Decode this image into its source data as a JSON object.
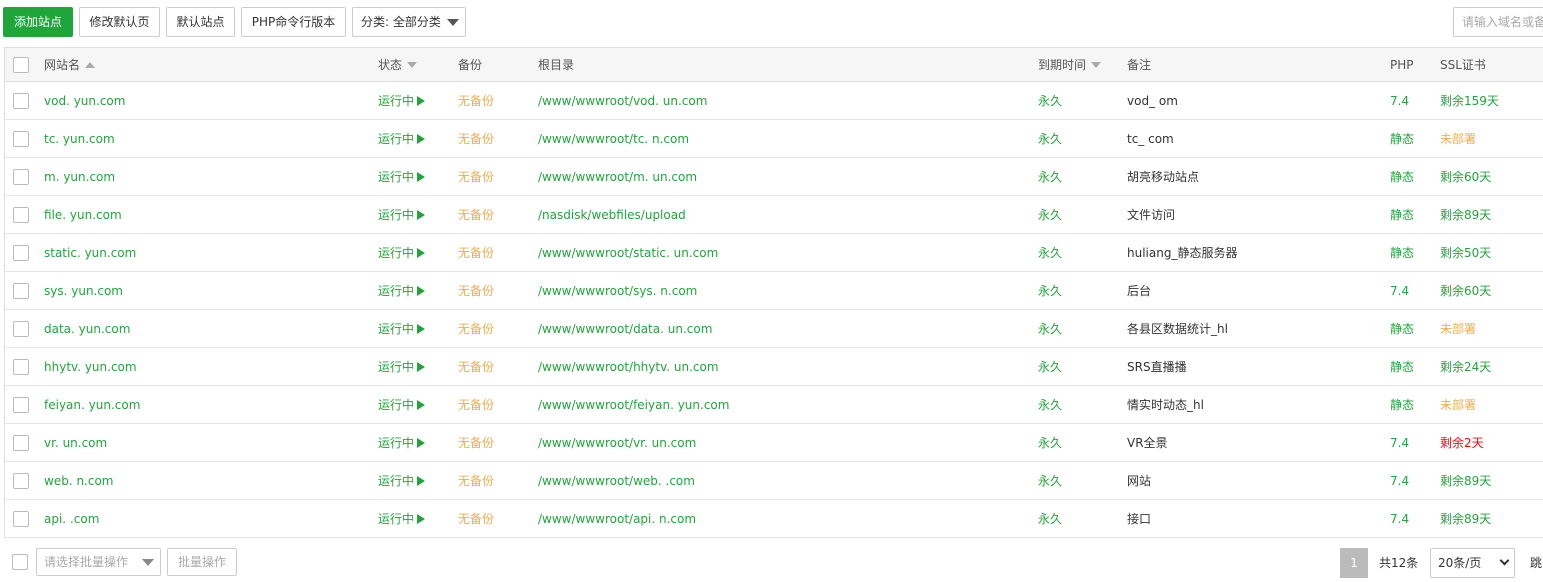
{
  "toolbar": {
    "add_site": "添加站点",
    "edit_default_page": "修改默认页",
    "default_site": "默认站点",
    "php_cli_version": "PHP命令行版本",
    "category": "分类: 全部分类",
    "search_placeholder": "请输入域名或备注"
  },
  "table": {
    "headers": {
      "name": "网站名",
      "status": "状态",
      "backup": "备份",
      "root": "根目录",
      "expire": "到期时间",
      "remark": "备注",
      "php": "PHP",
      "ssl": "SSL证书"
    },
    "rows": [
      {
        "name": "vod.                    yun.com",
        "status": "运行中",
        "backup": "无备份",
        "root": "/www/wwwroot/vod.                    un.com",
        "expire": "永久",
        "remark": "vod_                              om",
        "php": "7.4",
        "ssl": "剩余159天",
        "ssl_state": "ok"
      },
      {
        "name": "tc.                       yun.com",
        "status": "运行中",
        "backup": "无备份",
        "root": "/www/wwwroot/tc.                      n.com",
        "expire": "永久",
        "remark": "tc_                                com",
        "php": "静态",
        "ssl": "未部署",
        "ssl_state": "none"
      },
      {
        "name": "m.                        yun.com",
        "status": "运行中",
        "backup": "无备份",
        "root": "/www/wwwroot/m.                       un.com",
        "expire": "永久",
        "remark": "胡亮移动站点",
        "php": "静态",
        "ssl": "剩余60天",
        "ssl_state": "ok"
      },
      {
        "name": "file.                     yun.com",
        "status": "运行中",
        "backup": "无备份",
        "root": "/nasdisk/webfiles/upload",
        "expire": "永久",
        "remark": "文件访问",
        "php": "静态",
        "ssl": "剩余89天",
        "ssl_state": "ok"
      },
      {
        "name": "static.                   yun.com",
        "status": "运行中",
        "backup": "无备份",
        "root": "/www/wwwroot/static.                   un.com",
        "expire": "永久",
        "remark": "huliang_静态服务器",
        "php": "静态",
        "ssl": "剩余50天",
        "ssl_state": "ok"
      },
      {
        "name": "sys.                      yun.com",
        "status": "运行中",
        "backup": "无备份",
        "root": "/www/wwwroot/sys.                      n.com",
        "expire": "永久",
        "remark": "后台",
        "php": "7.4",
        "ssl": "剩余60天",
        "ssl_state": "ok"
      },
      {
        "name": "data.                     yun.com",
        "status": "运行中",
        "backup": "无备份",
        "root": "/www/wwwroot/data.                     un.com",
        "expire": "永久",
        "remark": "各县区数据统计_hl",
        "php": "静态",
        "ssl": "未部署",
        "ssl_state": "none"
      },
      {
        "name": "hhytv.                    yun.com",
        "status": "运行中",
        "backup": "无备份",
        "root": "/www/wwwroot/hhytv.                    un.com",
        "expire": "永久",
        "remark": "SRS直播播",
        "php": "静态",
        "ssl": "剩余24天",
        "ssl_state": "ok"
      },
      {
        "name": "feiyan.                   yun.com",
        "status": "运行中",
        "backup": "无备份",
        "root": "/www/wwwroot/feiyan.                   yun.com",
        "expire": "永久",
        "remark": "         情实时动态_hl",
        "php": "静态",
        "ssl": "未部署",
        "ssl_state": "none"
      },
      {
        "name": "vr.                       un.com",
        "status": "运行中",
        "backup": "无备份",
        "root": "/www/wwwroot/vr.                       un.com",
        "expire": "永久",
        "remark": "VR全景",
        "php": "7.4",
        "ssl": "剩余2天",
        "ssl_state": "warn"
      },
      {
        "name": "web.                      n.com",
        "status": "运行中",
        "backup": "无备份",
        "root": "/www/wwwroot/web.                       .com",
        "expire": "永久",
        "remark": "网站",
        "php": "7.4",
        "ssl": "剩余89天",
        "ssl_state": "ok"
      },
      {
        "name": "api.                      .com",
        "status": "运行中",
        "backup": "无备份",
        "root": "/www/wwwroot/api.                       n.com",
        "expire": "永久",
        "remark": "接口",
        "php": "7.4",
        "ssl": "剩余89天",
        "ssl_state": "ok"
      }
    ]
  },
  "footer": {
    "batch_placeholder": "请选择批量操作",
    "batch_button": "批量操作",
    "current_page": "1",
    "total": "共12条",
    "page_size": "20条/页",
    "jump": "跳"
  },
  "colors": {
    "primary": "#20a53a",
    "warning": "#f0ad4e",
    "danger": "#ef0808"
  }
}
